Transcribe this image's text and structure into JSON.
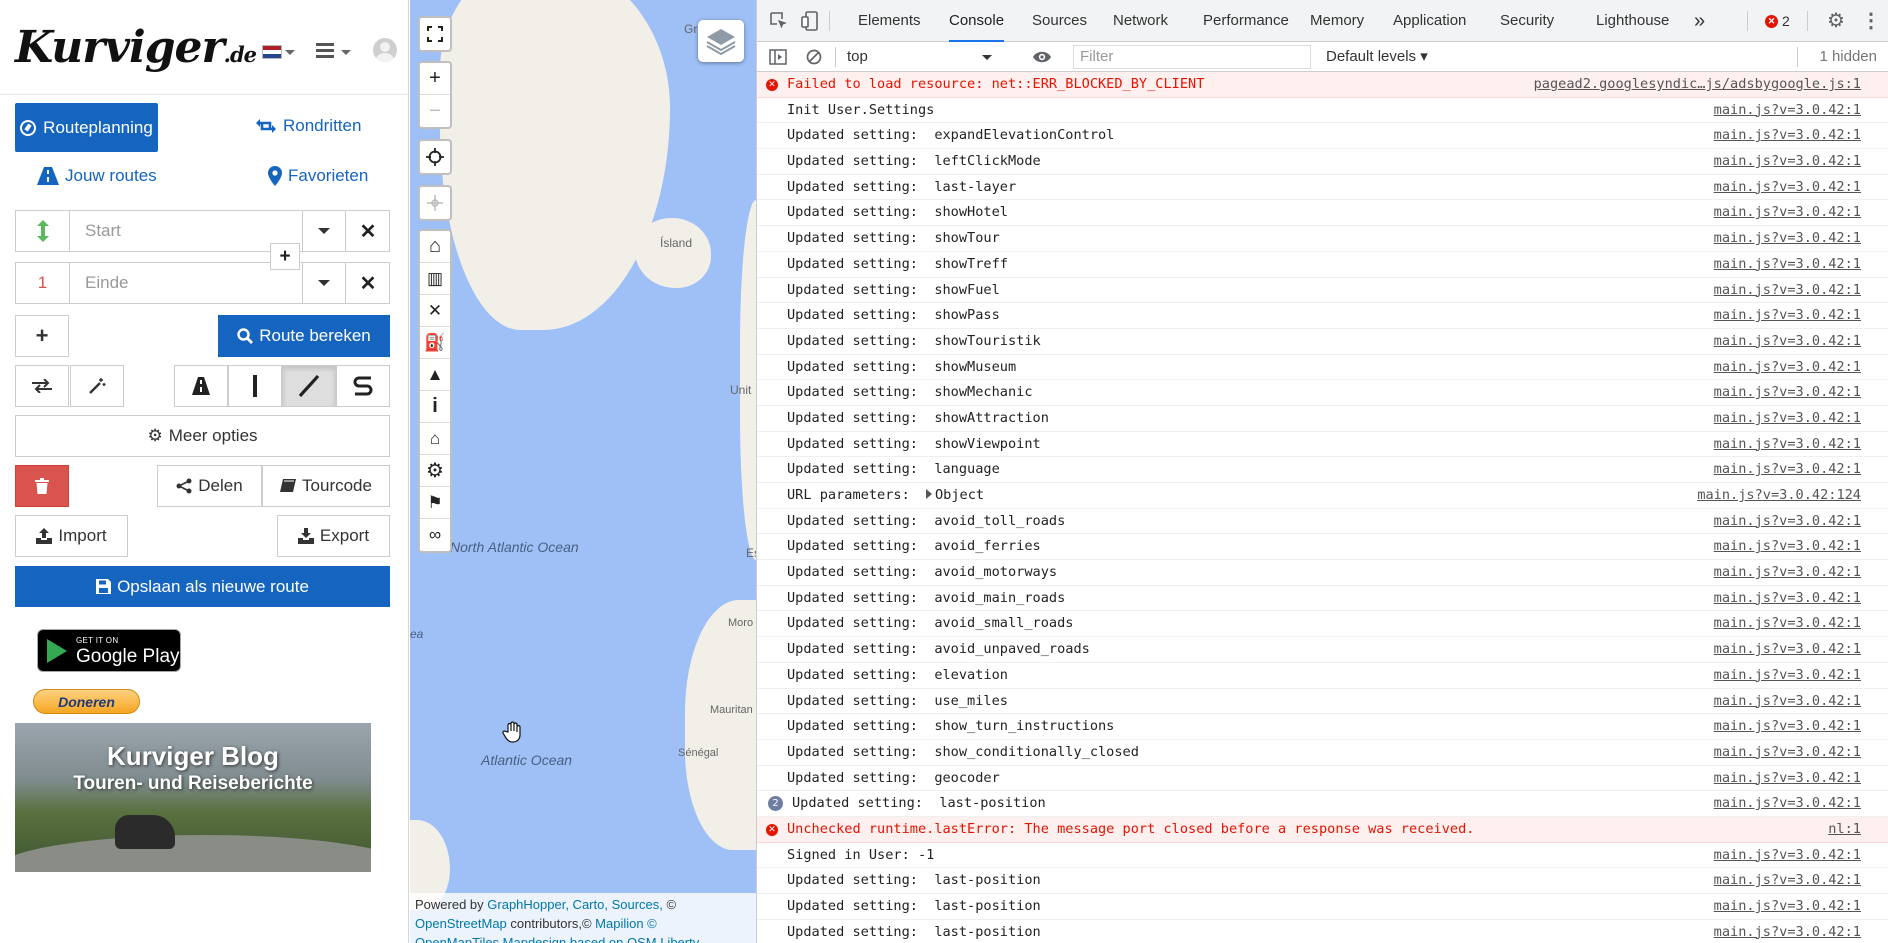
{
  "app": {
    "logo": "Kurviger",
    "logo_suffix": ".de",
    "tabs": {
      "route_planning": "Routeplanning",
      "round_trips": "Rondritten",
      "your_routes": "Jouw routes",
      "favorites": "Favorieten"
    },
    "start_placeholder": "Start",
    "end_placeholder": "Einde",
    "end_index": "1",
    "calculate_route": "Route bereken",
    "more_options": "Meer opties",
    "share": "Delen",
    "tourcode": "Tourcode",
    "import": "Import",
    "export": "Export",
    "save_new_route": "Opslaan als nieuwe route",
    "google_play_line1": "GET IT ON",
    "google_play_line2": "Google Play",
    "donate": "Doneren",
    "blog_title": "Kurviger Blog",
    "blog_subtitle": "Touren- und Reiseberichte",
    "colors": {
      "primary": "#1565c0",
      "danger": "#d9534f",
      "start_icon": "#5cb85c",
      "end_number": "#d9534f"
    }
  },
  "map": {
    "labels": {
      "iceland": "Ísland",
      "north_atlantic": "North Atlantic Ocean",
      "atlantic": "Atlantic Ocean",
      "greenland": "Gr",
      "unit": "Unit",
      "es": "Es",
      "moro": "Moro",
      "mauritan": "Mauritan",
      "senegal": "Sénégal",
      "ea": "ea"
    },
    "attribution_line1_prefix": "Powered by",
    "attribution_links1": "GraphHopper, Carto, Sources,",
    "attribution_copy": "©",
    "attribution_osm": "OpenStreetMap",
    "attribution_contrib": "contributors,©",
    "attribution_mapilion": "Mapilion ©",
    "attribution_line3": "OpenMapTiles Mapdesign based on OSM Liberty"
  },
  "devtools": {
    "tabs": [
      "Elements",
      "Console",
      "Sources",
      "Network",
      "Performance",
      "Memory",
      "Application",
      "Security",
      "Lighthouse"
    ],
    "selected_tab": "Console",
    "more_tabs": "»",
    "error_count": "2",
    "context": "top",
    "filter_placeholder": "Filter",
    "levels": "Default levels ▾",
    "hidden": "1 hidden",
    "logs": [
      {
        "type": "error",
        "msg": "Failed to load resource: net::ERR_BLOCKED_BY_CLIENT",
        "src": "pagead2.googlesyndic…js/adsbygoogle.js:1"
      },
      {
        "type": "log",
        "msg": "Init User.Settings",
        "src": "main.js?v=3.0.42:1"
      },
      {
        "type": "log",
        "msg": "Updated setting:  expandElevationControl",
        "src": "main.js?v=3.0.42:1"
      },
      {
        "type": "log",
        "msg": "Updated setting:  leftClickMode",
        "src": "main.js?v=3.0.42:1"
      },
      {
        "type": "log",
        "msg": "Updated setting:  last-layer",
        "src": "main.js?v=3.0.42:1"
      },
      {
        "type": "log",
        "msg": "Updated setting:  showHotel",
        "src": "main.js?v=3.0.42:1"
      },
      {
        "type": "log",
        "msg": "Updated setting:  showTour",
        "src": "main.js?v=3.0.42:1"
      },
      {
        "type": "log",
        "msg": "Updated setting:  showTreff",
        "src": "main.js?v=3.0.42:1"
      },
      {
        "type": "log",
        "msg": "Updated setting:  showFuel",
        "src": "main.js?v=3.0.42:1"
      },
      {
        "type": "log",
        "msg": "Updated setting:  showPass",
        "src": "main.js?v=3.0.42:1"
      },
      {
        "type": "log",
        "msg": "Updated setting:  showTouristik",
        "src": "main.js?v=3.0.42:1"
      },
      {
        "type": "log",
        "msg": "Updated setting:  showMuseum",
        "src": "main.js?v=3.0.42:1"
      },
      {
        "type": "log",
        "msg": "Updated setting:  showMechanic",
        "src": "main.js?v=3.0.42:1"
      },
      {
        "type": "log",
        "msg": "Updated setting:  showAttraction",
        "src": "main.js?v=3.0.42:1"
      },
      {
        "type": "log",
        "msg": "Updated setting:  showViewpoint",
        "src": "main.js?v=3.0.42:1"
      },
      {
        "type": "log",
        "msg": "Updated setting:  language",
        "src": "main.js?v=3.0.42:1"
      },
      {
        "type": "object",
        "msg": "URL parameters: ",
        "obj": "Object",
        "src": "main.js?v=3.0.42:124"
      },
      {
        "type": "log",
        "msg": "Updated setting:  avoid_toll_roads",
        "src": "main.js?v=3.0.42:1"
      },
      {
        "type": "log",
        "msg": "Updated setting:  avoid_ferries",
        "src": "main.js?v=3.0.42:1"
      },
      {
        "type": "log",
        "msg": "Updated setting:  avoid_motorways",
        "src": "main.js?v=3.0.42:1"
      },
      {
        "type": "log",
        "msg": "Updated setting:  avoid_main_roads",
        "src": "main.js?v=3.0.42:1"
      },
      {
        "type": "log",
        "msg": "Updated setting:  avoid_small_roads",
        "src": "main.js?v=3.0.42:1"
      },
      {
        "type": "log",
        "msg": "Updated setting:  avoid_unpaved_roads",
        "src": "main.js?v=3.0.42:1"
      },
      {
        "type": "log",
        "msg": "Updated setting:  elevation",
        "src": "main.js?v=3.0.42:1"
      },
      {
        "type": "log",
        "msg": "Updated setting:  use_miles",
        "src": "main.js?v=3.0.42:1"
      },
      {
        "type": "log",
        "msg": "Updated setting:  show_turn_instructions",
        "src": "main.js?v=3.0.42:1"
      },
      {
        "type": "log",
        "msg": "Updated setting:  show_conditionally_closed",
        "src": "main.js?v=3.0.42:1"
      },
      {
        "type": "log",
        "msg": "Updated setting:  geocoder",
        "src": "main.js?v=3.0.42:1"
      },
      {
        "type": "count",
        "count": "2",
        "msg": "Updated setting:  last-position",
        "src": "main.js?v=3.0.42:1"
      },
      {
        "type": "error",
        "msg": "Unchecked runtime.lastError: The message port closed before a response was received.",
        "src": "nl:1"
      },
      {
        "type": "log",
        "msg": "Signed in User: -1",
        "src": "main.js?v=3.0.42:1"
      },
      {
        "type": "log",
        "msg": "Updated setting:  last-position",
        "src": "main.js?v=3.0.42:1"
      },
      {
        "type": "log",
        "msg": "Updated setting:  last-position",
        "src": "main.js?v=3.0.42:1"
      },
      {
        "type": "log",
        "msg": "Updated setting:  last-position",
        "src": "main.js?v=3.0.42:1"
      }
    ]
  }
}
